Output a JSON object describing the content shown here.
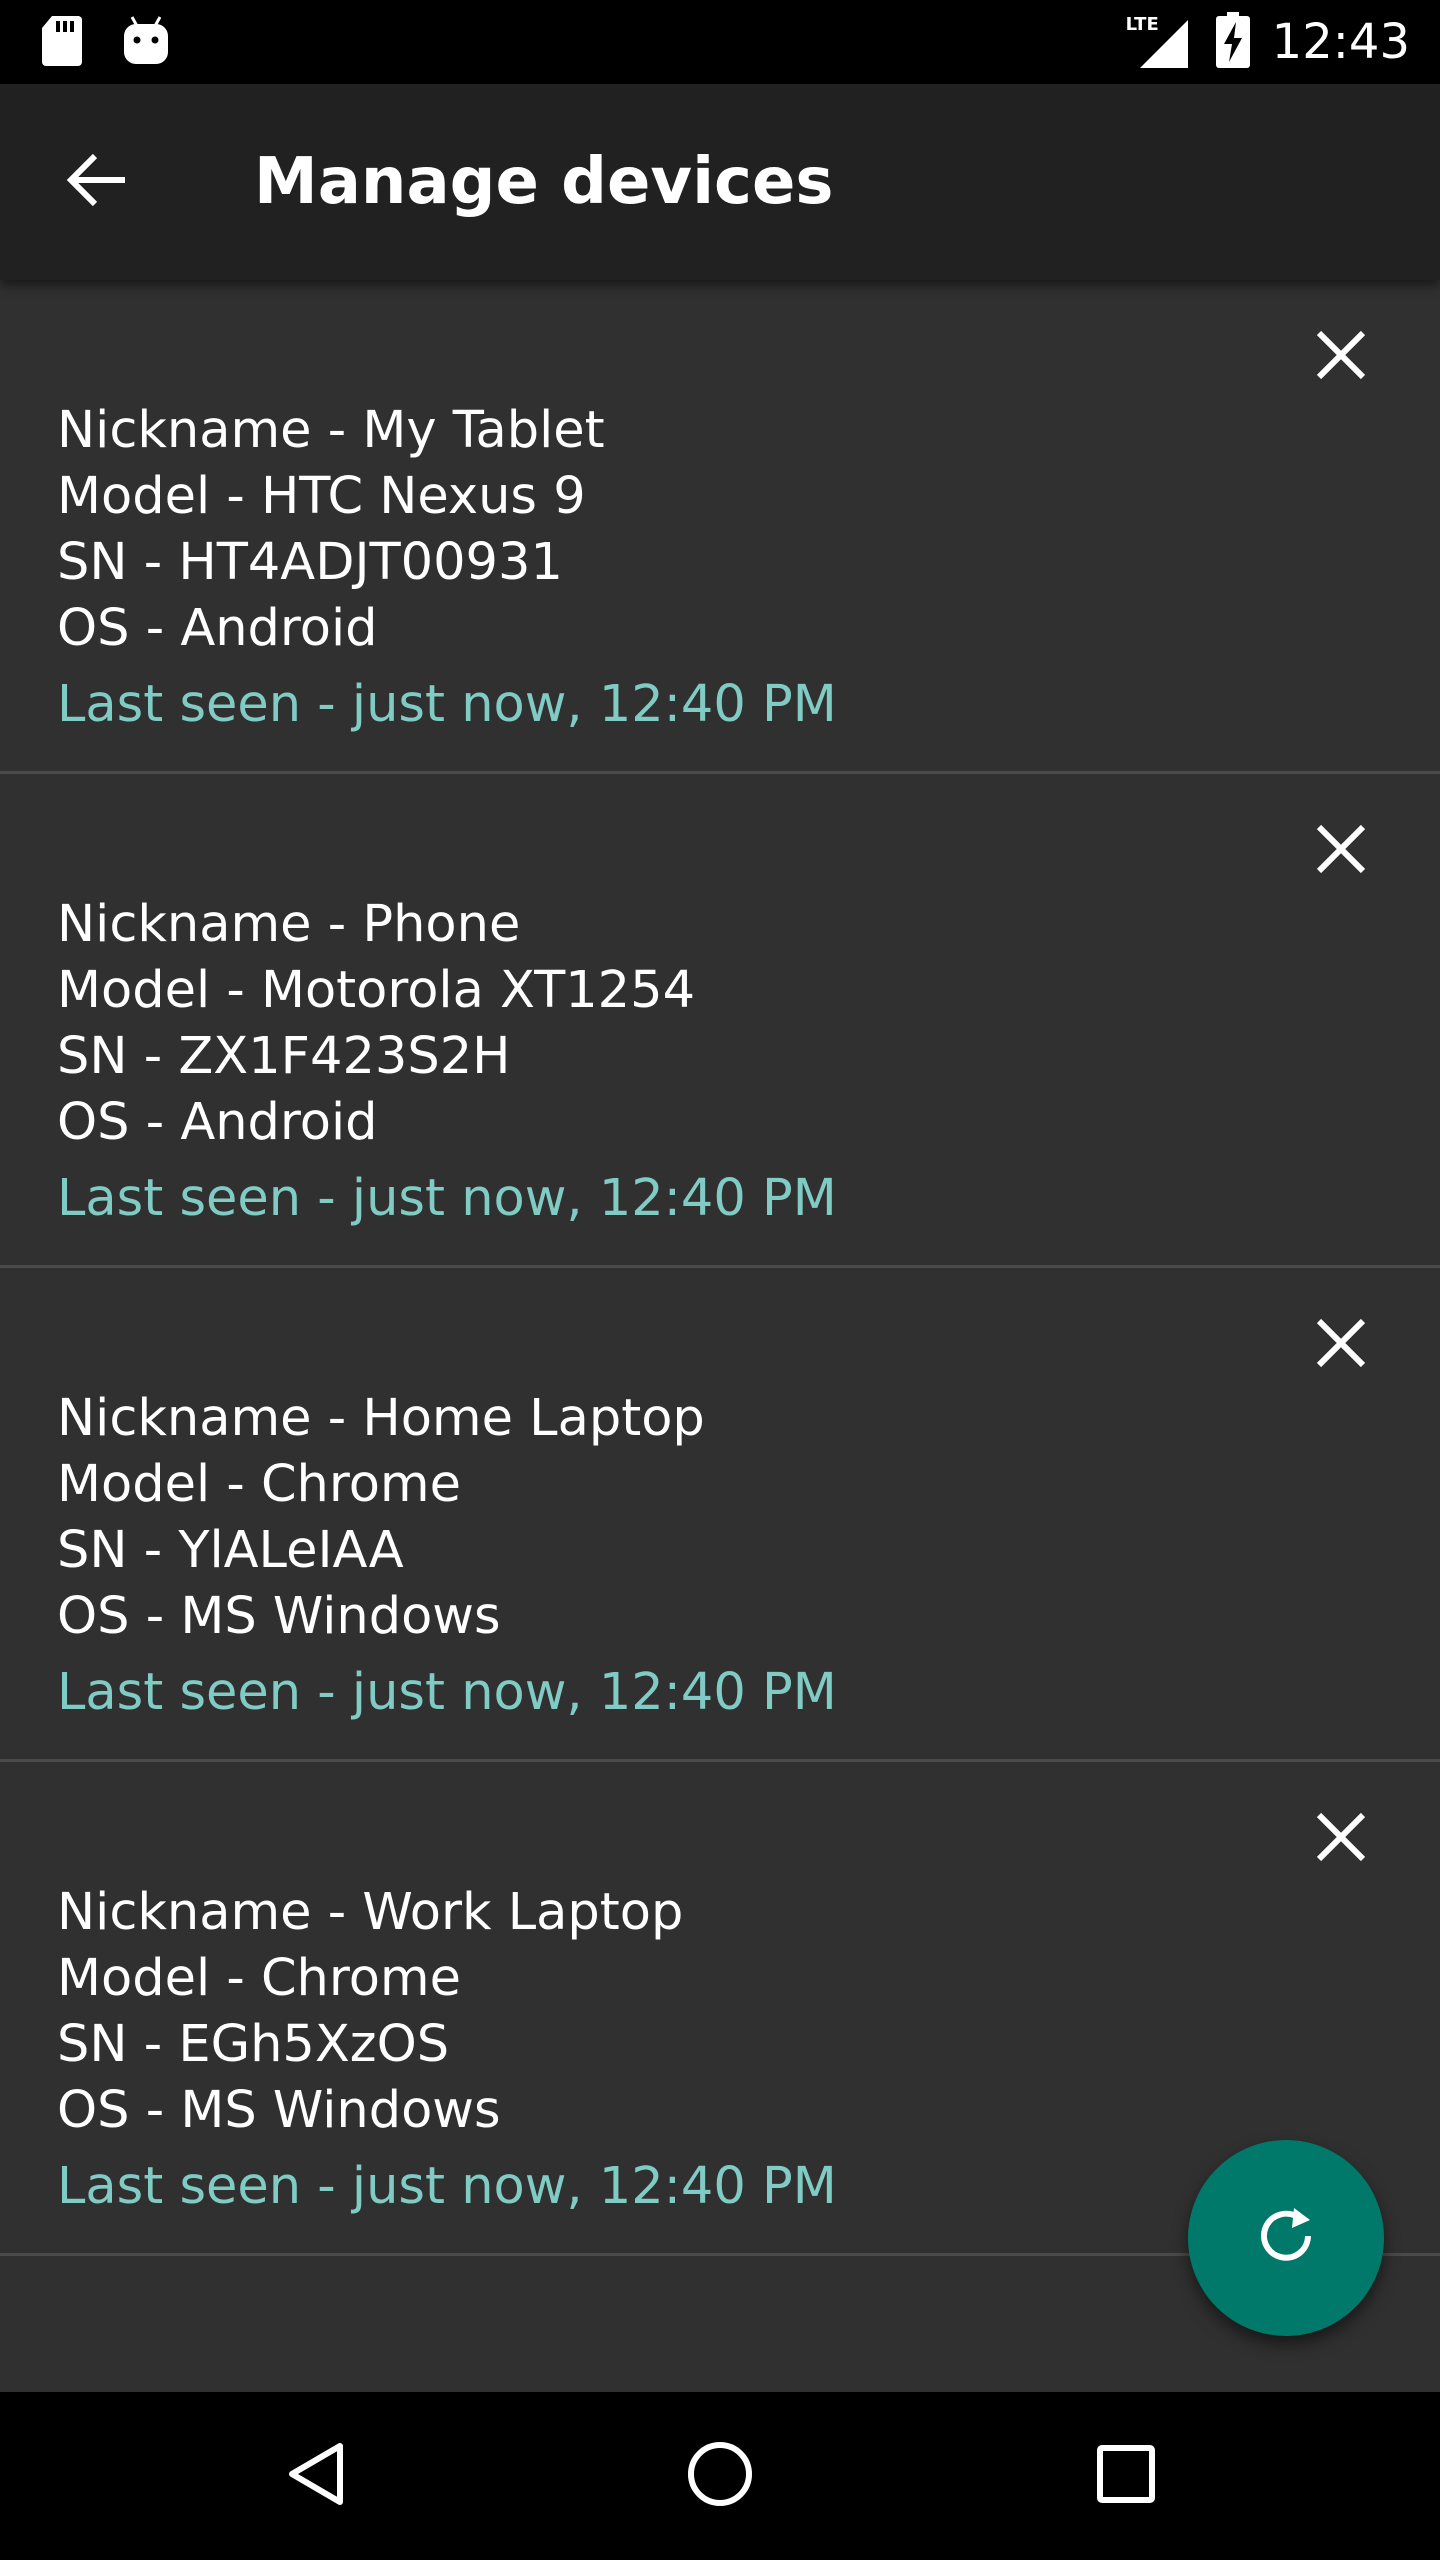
{
  "status_bar": {
    "time": "12:43",
    "network_label": "LTE",
    "left_icons": [
      "sd-card-icon",
      "android-icon"
    ],
    "right_icons": [
      "lte-signal-icon",
      "battery-charging-icon"
    ]
  },
  "app_bar": {
    "title": "Manage devices",
    "back_icon": "arrow-back-icon"
  },
  "devices": [
    {
      "nickname": "Nickname - My Tablet",
      "model": "Model - HTC Nexus 9",
      "sn": "SN - HT4ADJT00931",
      "os": "OS - Android",
      "last_seen": "Last seen - just now, 12:40 PM"
    },
    {
      "nickname": "Nickname - Phone",
      "model": "Model - Motorola XT1254",
      "sn": "SN - ZX1F423S2H",
      "os": "OS - Android",
      "last_seen": "Last seen - just now, 12:40 PM"
    },
    {
      "nickname": "Nickname - Home Laptop",
      "model": "Model - Chrome",
      "sn": "SN - YlALeIAA",
      "os": "OS - MS Windows",
      "last_seen": "Last seen - just now, 12:40 PM"
    },
    {
      "nickname": "Nickname - Work Laptop",
      "model": "Model - Chrome",
      "sn": "SN - EGh5XzOS",
      "os": "OS - MS Windows",
      "last_seen": "Last seen - just now, 12:40 PM"
    }
  ],
  "fab": {
    "icon": "refresh-icon",
    "color": "#00796b"
  },
  "nav_bar": {
    "icons": [
      "back-triangle-icon",
      "home-circle-icon",
      "recents-square-icon"
    ]
  },
  "colors": {
    "background": "#303030",
    "app_bar": "#212121",
    "accent_text": "#80cbc4",
    "divider": "#4a4a4a"
  }
}
